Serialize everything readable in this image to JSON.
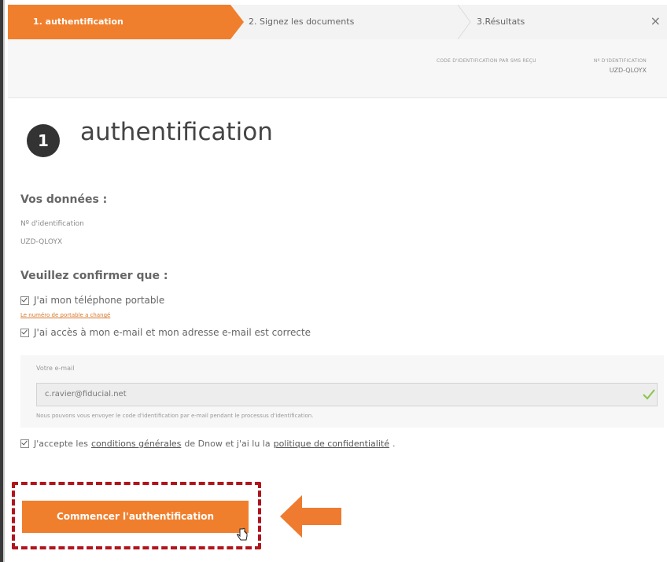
{
  "stepper": {
    "step1": "1. authentification",
    "step2": "2. Signez les documents",
    "step3": "3.Résultats",
    "close": "×"
  },
  "code_header": {
    "label1": "CODE D'IDENTIFICATION PAR SMS REÇU",
    "label2": "Nº D'IDENTIFICATION",
    "value": "UZD-QLOYX"
  },
  "title": {
    "number": "1",
    "text": "authentification"
  },
  "vos_donnees": {
    "heading": "Vos données :",
    "id_label": "Nº d'identification",
    "id_value": "UZD-QLOYX"
  },
  "confirm": {
    "heading": "Veuillez confirmer que :",
    "phone": "J'ai mon téléphone portable",
    "phone_link": "Le numéro de portable a changé",
    "email_access": "J'ai accès à mon e-mail et mon adresse e-mail est correcte"
  },
  "email": {
    "label": "Votre e-mail",
    "value": "c.ravier@fiducial.net",
    "help": "Nous pouvons vous envoyer le code d'identification par e-mail pendant le processus d'identification."
  },
  "terms": {
    "prefix": "J'accepte les",
    "link1": "conditions générales",
    "middle": "de Dnow et j'ai lu la",
    "link2": "politique de confidentialité",
    "suffix": "."
  },
  "action": {
    "button": "Commencer l'authentification"
  },
  "colors": {
    "accent": "#f07f2d",
    "highlight": "#b0141c"
  }
}
